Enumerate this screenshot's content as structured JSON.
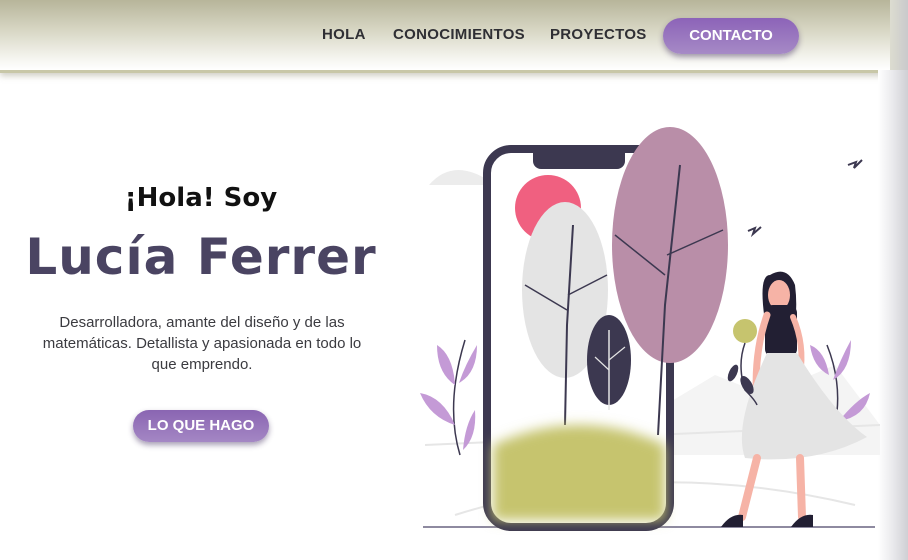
{
  "nav": {
    "items": [
      {
        "label": "HOLA"
      },
      {
        "label": "CONOCIMIENTOS"
      },
      {
        "label": "PROYECTOS"
      }
    ],
    "cta_label": "CONTACTO"
  },
  "hero": {
    "greeting": "¡Hola! Soy",
    "name": "Lucía Ferrer",
    "description_lines": [
      "Desarrolladora, amante del diseño y de las",
      "matemáticas. Detallista y apasionada en todo lo",
      "que emprendo."
    ],
    "cta_label": "LO QUE HAGO"
  },
  "colors": {
    "accent_purple": "#9b77c0",
    "name_color": "#4a4462",
    "nav_olive": "#b7b59a",
    "leaf_mauve": "#b98ea8",
    "sun_pink": "#f06080",
    "hill_olive": "#c6c46e"
  }
}
